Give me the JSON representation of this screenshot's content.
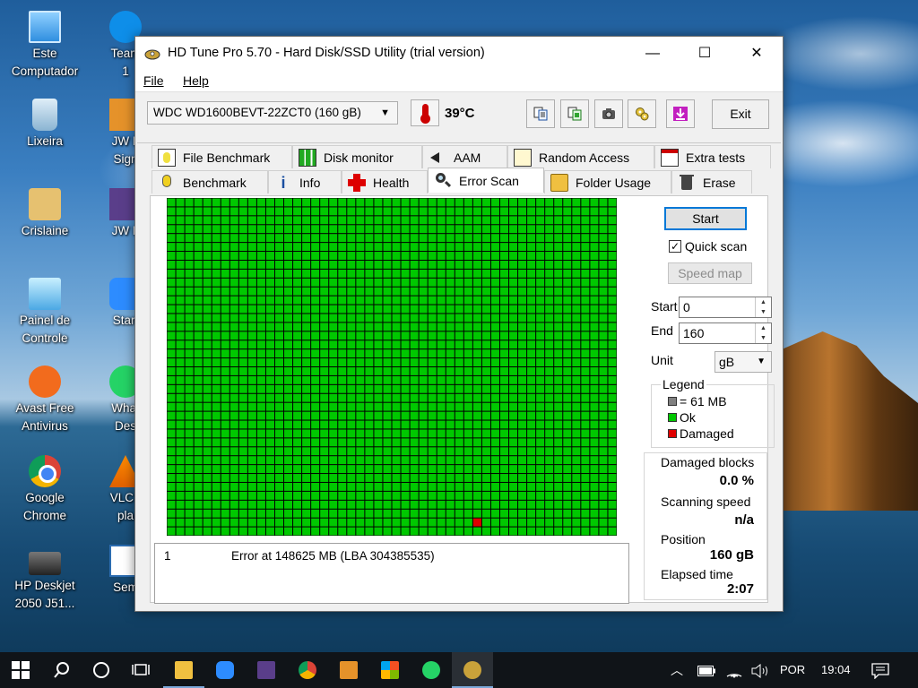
{
  "desktop": {
    "icons": [
      {
        "label": "Este\nComputador"
      },
      {
        "label": "Lixeira"
      },
      {
        "label": "Crislaine"
      },
      {
        "label": "Painel de\nControle"
      },
      {
        "label": "Avast Free\nAntivirus"
      },
      {
        "label": "Google\nChrome"
      },
      {
        "label": "HP Deskjet\n2050 J51..."
      },
      {
        "label": "Team\n1"
      },
      {
        "label": "JW L\nSign"
      },
      {
        "label": "JW L"
      },
      {
        "label": "Start"
      },
      {
        "label": "What\nDes"
      },
      {
        "label": "VLC r\npla"
      },
      {
        "label": "Sem"
      }
    ]
  },
  "window": {
    "title": "HD Tune Pro 5.70 - Hard Disk/SSD Utility (trial version)",
    "controls": {
      "minimize": "—",
      "maximize": "☐",
      "close": "✕"
    },
    "menu": {
      "file": "File",
      "help": "Help"
    },
    "toolbar": {
      "drive": "WDC WD1600BEVT-22ZCT0 (160 gB)",
      "temperature": "39°C",
      "exit": "Exit",
      "icons": [
        "copy-text-icon",
        "copy-screenshot-icon",
        "camera-icon",
        "options-icon",
        "save-download-icon"
      ]
    },
    "tabs_top": [
      "File Benchmark",
      "Disk monitor",
      "AAM",
      "Random Access",
      "Extra tests"
    ],
    "tabs_bottom": [
      "Benchmark",
      "Info",
      "Health",
      "Error Scan",
      "Folder Usage",
      "Erase"
    ],
    "active_tab": "Error Scan",
    "error_scan": {
      "grid": {
        "cols": 50,
        "rows": 38,
        "damaged": [
          {
            "col": 34,
            "row": 36
          }
        ]
      },
      "colors": {
        "ok": "#00c800",
        "damaged": "#e00000",
        "block": "#808080"
      },
      "log": [
        {
          "num": "1",
          "message": "Error at 148625 MB (LBA 304385535)"
        }
      ],
      "start_button": "Start",
      "quick_scan_label": "Quick scan",
      "quick_scan_checked": "✓",
      "speed_map_button": "Speed map",
      "start_label": "Start",
      "start_value": "0",
      "end_label": "End",
      "end_value": "160",
      "unit_label": "Unit",
      "unit_value": "gB",
      "legend": {
        "title": "Legend",
        "block": "= 61 MB",
        "ok": "Ok",
        "damaged": "Damaged"
      },
      "stats": {
        "damaged_blocks_label": "Damaged blocks",
        "damaged_blocks_value": "0.0 %",
        "scanning_speed_label": "Scanning speed",
        "scanning_speed_value": "n/a",
        "position_label": "Position",
        "position_value": "160 gB",
        "elapsed_label": "Elapsed time",
        "elapsed_value": "2:07"
      }
    }
  },
  "taskbar": {
    "language": "POR",
    "time": "19:04"
  }
}
